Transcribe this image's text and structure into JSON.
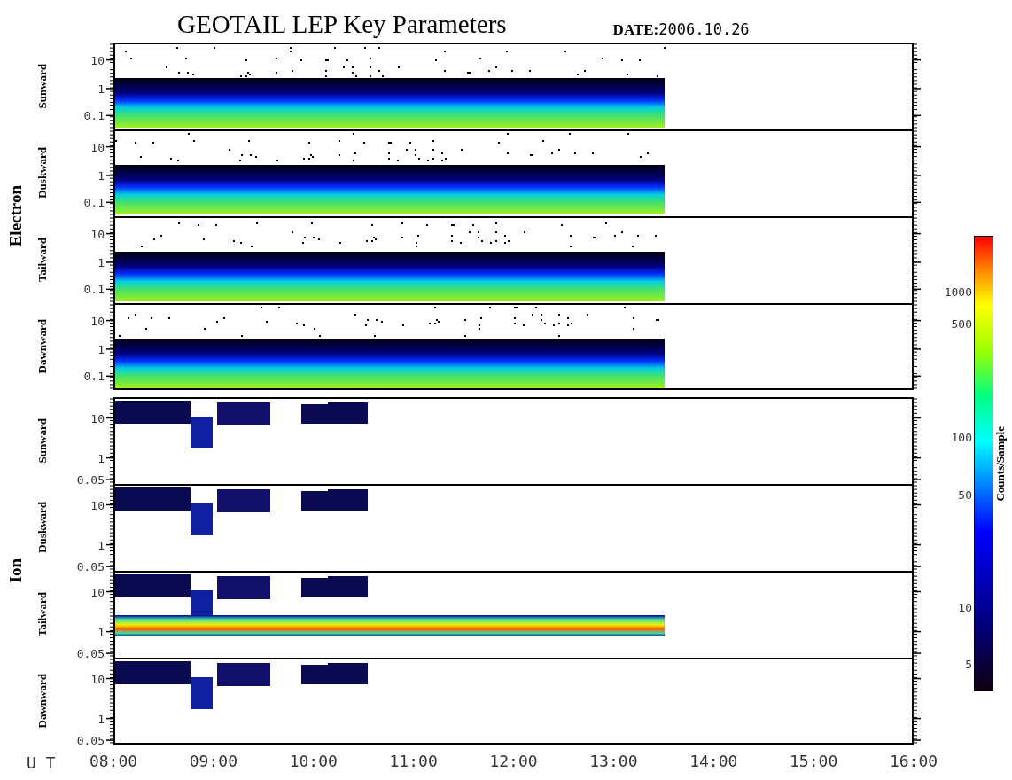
{
  "title": "GEOTAIL LEP Key Parameters",
  "date": {
    "label": "DATE:",
    "value": "2006.10.26"
  },
  "groups": [
    {
      "name": "Electron",
      "panels": [
        {
          "label": "Sunward",
          "kind": "electron",
          "yticks": [
            "10",
            "1",
            "0.1"
          ]
        },
        {
          "label": "Duskward",
          "kind": "electron",
          "yticks": [
            "10",
            "1",
            "0.1"
          ]
        },
        {
          "label": "Tailward",
          "kind": "electron",
          "yticks": [
            "10",
            "1",
            "0.1"
          ]
        },
        {
          "label": "Dawnward",
          "kind": "electron",
          "yticks": [
            "10",
            "1",
            "0.1"
          ]
        }
      ]
    },
    {
      "name": "Ion",
      "panels": [
        {
          "label": "Sunward",
          "kind": "ion",
          "yticks": [
            "10",
            "1",
            "0.05"
          ]
        },
        {
          "label": "Duskward",
          "kind": "ion",
          "yticks": [
            "10",
            "1",
            "0.05"
          ]
        },
        {
          "label": "Tailward",
          "kind": "ion-band",
          "yticks": [
            "10",
            "1",
            "0.05"
          ]
        },
        {
          "label": "Dawnward",
          "kind": "ion",
          "yticks": [
            "10",
            "1",
            "0.05"
          ]
        }
      ]
    }
  ],
  "colorbar": {
    "label": "Counts/Sample",
    "ticks": [
      "1000",
      "500",
      "100",
      "50",
      "10",
      "5"
    ]
  },
  "xaxis": {
    "label": "U T",
    "ticks": [
      "08:00",
      "09:00",
      "10:00",
      "11:00",
      "12:00",
      "13:00",
      "14:00",
      "15:00",
      "16:00"
    ]
  }
}
